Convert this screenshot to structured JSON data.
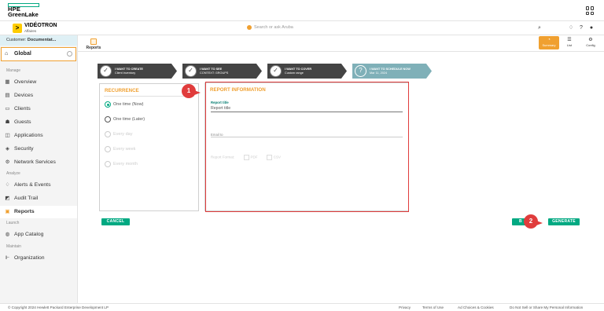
{
  "topbar": {
    "logo_line1": "HPE",
    "logo_line2": "GreenLake"
  },
  "appbar": {
    "brand_name": "VIDÉOTRON",
    "brand_sub": "Affaires",
    "brand_mark": ">",
    "search_placeholder": "Search or ask Aruba"
  },
  "sidebar": {
    "customer_prefix": "Customer: ",
    "customer_name": "Documentat...",
    "global_label": "Global",
    "sections": {
      "manage": "Manage",
      "analyze": "Analyze",
      "launch": "Launch",
      "maintain": "Maintain"
    },
    "items": [
      {
        "label": "Overview"
      },
      {
        "label": "Devices"
      },
      {
        "label": "Clients"
      },
      {
        "label": "Guests"
      },
      {
        "label": "Applications"
      },
      {
        "label": "Security"
      },
      {
        "label": "Network Services"
      },
      {
        "label": "Alerts & Events"
      },
      {
        "label": "Audit Trail"
      },
      {
        "label": "Reports"
      },
      {
        "label": "App Catalog"
      },
      {
        "label": "Organization"
      }
    ]
  },
  "content_head": {
    "reports_tab": "Reports",
    "views": [
      {
        "label": "Summary"
      },
      {
        "label": "List"
      },
      {
        "label": "Config"
      }
    ]
  },
  "steps": [
    {
      "line1": "I WANT TO CREATE",
      "line2": "Client inventory"
    },
    {
      "line1": "I WANT TO SEE",
      "line2": "CONTEXT: GROUPS"
    },
    {
      "line1": "I WANT TO COVER",
      "line2": "Custom range"
    },
    {
      "line1": "I WANT TO SCHEDULE NOW",
      "line2": "Mar 11, 2024"
    }
  ],
  "recurrence": {
    "title": "RECURRENCE",
    "options": [
      {
        "label": "One time (Now)"
      },
      {
        "label": "One time (Later)"
      },
      {
        "label": "Every day"
      },
      {
        "label": "Every week"
      },
      {
        "label": "Every month"
      }
    ]
  },
  "report_info": {
    "title": "REPORT INFORMATION",
    "report_title_label": "Report title",
    "report_title_value": "Report title",
    "email_label": "Email to",
    "format_label": "Report Format:",
    "format_pdf": "PDF",
    "format_csv": "CSV"
  },
  "buttons": {
    "cancel": "CANCEL",
    "back": "B",
    "generate": "GENERATE"
  },
  "badges": {
    "one": "1",
    "two": "2"
  },
  "footer": {
    "copyright": "© Copyright 2024 Hewlett Packard Enterprise Development LP",
    "privacy": "Privacy",
    "terms": "Terms of Use",
    "ad_choices": "Ad Choices & Cookies",
    "do_not_sell": "Do Not Sell or Share My Personal Information"
  },
  "colors": {
    "accent": "#f0a030",
    "primary": "#01a982",
    "highlight": "#e03c3c"
  }
}
